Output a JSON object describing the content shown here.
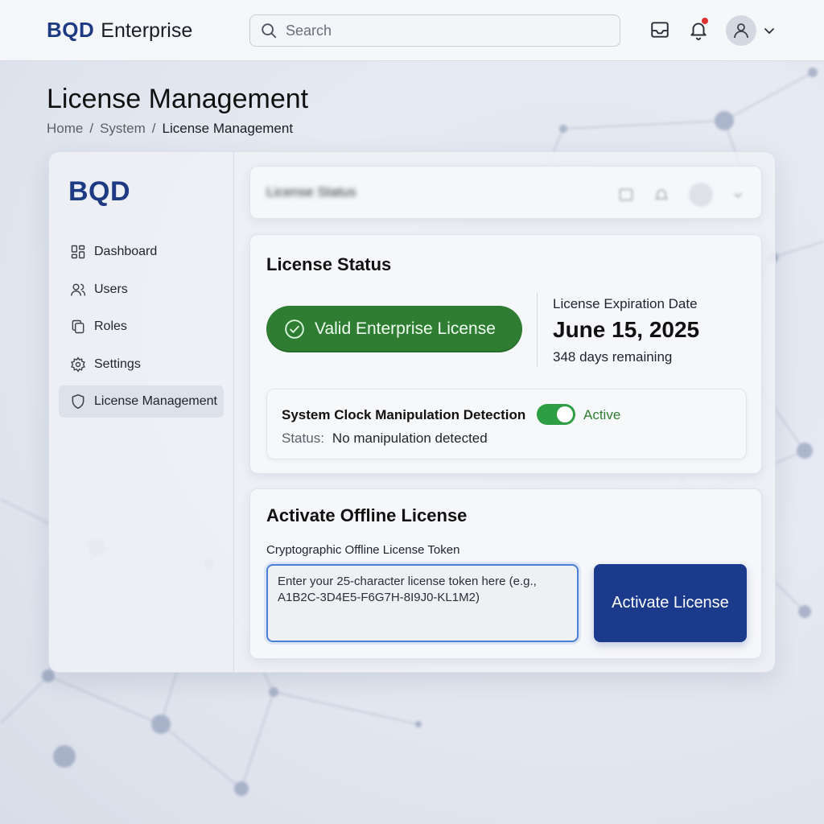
{
  "header": {
    "brand_mark": "BQD",
    "brand_name": "Enterprise",
    "search_placeholder": "Search",
    "icons": [
      "search-icon",
      "inbox-icon",
      "bell-icon",
      "user-icon",
      "chevron-down-icon"
    ]
  },
  "page": {
    "title": "License Management",
    "breadcrumb": [
      "Home",
      "System",
      "License Management"
    ],
    "separator": "/"
  },
  "sidebar": {
    "logo": "BQD",
    "items": [
      {
        "label": "Dashboard",
        "icon": "dashboard-icon"
      },
      {
        "label": "Users",
        "icon": "users-icon"
      },
      {
        "label": "Roles",
        "icon": "roles-icon"
      },
      {
        "label": "Settings",
        "icon": "gear-icon"
      },
      {
        "label": "License Management",
        "icon": "shield-icon",
        "active": true
      }
    ]
  },
  "blurred_header": {
    "title": "License Status"
  },
  "license_status": {
    "title": "License Status",
    "badge": "Valid Enterprise License",
    "expiration_label": "License Expiration Date",
    "expiration_date": "June 15, 2025",
    "days_remaining": "348 days remaining",
    "clock_detection": {
      "title": "System Clock Manipulation Detection",
      "toggle_on": true,
      "toggle_label": "Active",
      "status_key": "Status:",
      "status_value": "No manipulation detected"
    }
  },
  "offline_activation": {
    "title": "Activate Offline License",
    "token_label": "Cryptographic Offline License Token",
    "token_placeholder": "Enter your 25-character license token here (e.g., A1B2C-3D4E5-F6G7H-8I9J0-KL1M2)",
    "button_label": "Activate License"
  },
  "colors": {
    "brand": "#1d3a82",
    "success": "#2e7d32",
    "toggle": "#2e9e44",
    "primary_button": "#1b3a8c",
    "notification_dot": "#e03131"
  }
}
